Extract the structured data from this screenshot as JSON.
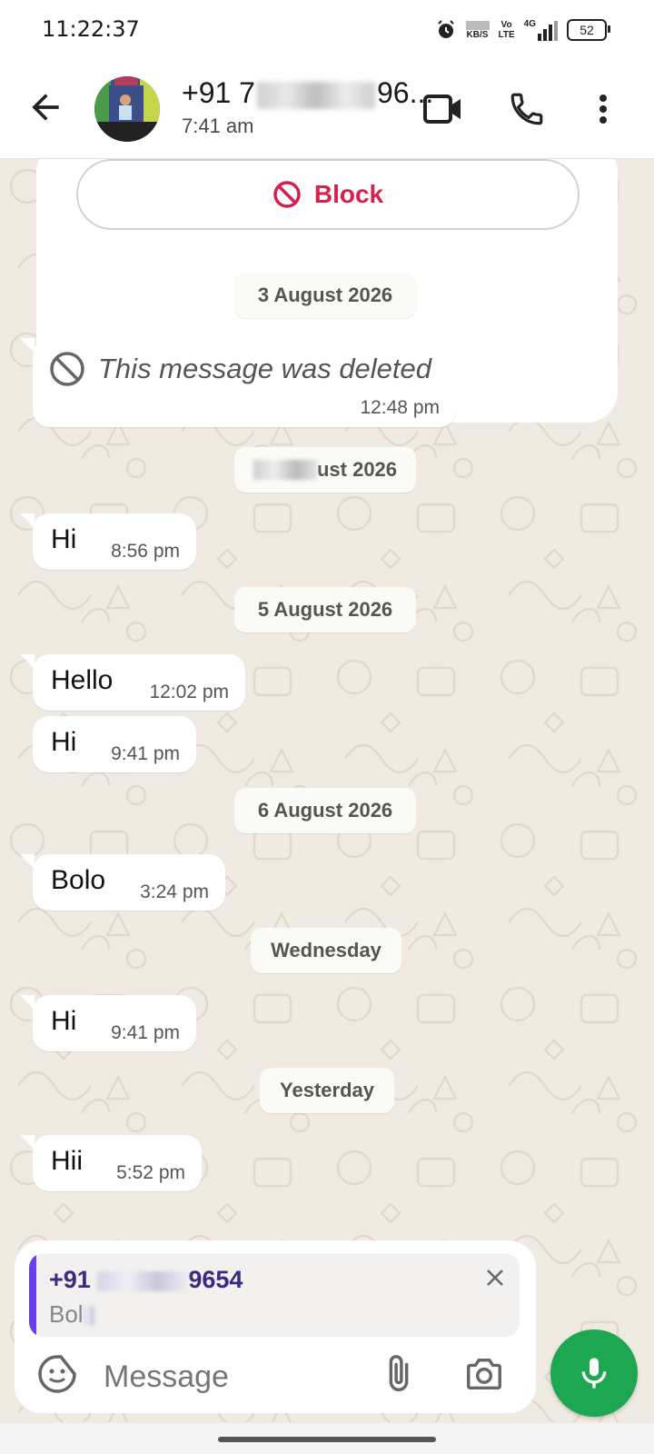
{
  "status": {
    "time": "11:22:37",
    "net_speed_unit": "KB/S",
    "volte_top": "Vo",
    "volte_bottom": "LTE",
    "network": "4G",
    "battery": "52"
  },
  "header": {
    "contact_prefix": "+91 7",
    "contact_suffix": "96...",
    "last_seen": "7:41 am"
  },
  "block": {
    "label": "Block"
  },
  "messages": [
    {
      "type": "date",
      "label": "3 August 2026"
    },
    {
      "type": "deleted",
      "text": "This message was deleted",
      "time": "12:48 pm"
    },
    {
      "type": "date",
      "label": "ust 2026"
    },
    {
      "type": "msg",
      "text": "Hi",
      "time": "8:56 pm"
    },
    {
      "type": "date",
      "label": "5 August 2026"
    },
    {
      "type": "msg",
      "text": "Hello",
      "time": "12:02 pm"
    },
    {
      "type": "msg",
      "text": "Hi",
      "time": "9:41 pm"
    },
    {
      "type": "date",
      "label": "6 August 2026"
    },
    {
      "type": "msg",
      "text": "Bolo",
      "time": "3:24 pm"
    },
    {
      "type": "date",
      "label": "Wednesday"
    },
    {
      "type": "msg",
      "text": "Hi",
      "time": "9:41 pm"
    },
    {
      "type": "date",
      "label": "Yesterday"
    },
    {
      "type": "msg",
      "text": "Hii",
      "time": "5:52 pm"
    }
  ],
  "reply": {
    "name_prefix": "+91",
    "name_suffix": "9654",
    "text": "Bol"
  },
  "composer": {
    "placeholder": "Message"
  },
  "colors": {
    "accent_green": "#1da750",
    "block_red": "#d6204e",
    "reply_bar": "#6b3df0"
  },
  "icons": [
    "back-arrow-icon",
    "video-call-icon",
    "phone-icon",
    "more-vert-icon",
    "block-icon",
    "deleted-icon",
    "close-icon",
    "sticker-icon",
    "attach-icon",
    "camera-icon",
    "mic-icon"
  ]
}
